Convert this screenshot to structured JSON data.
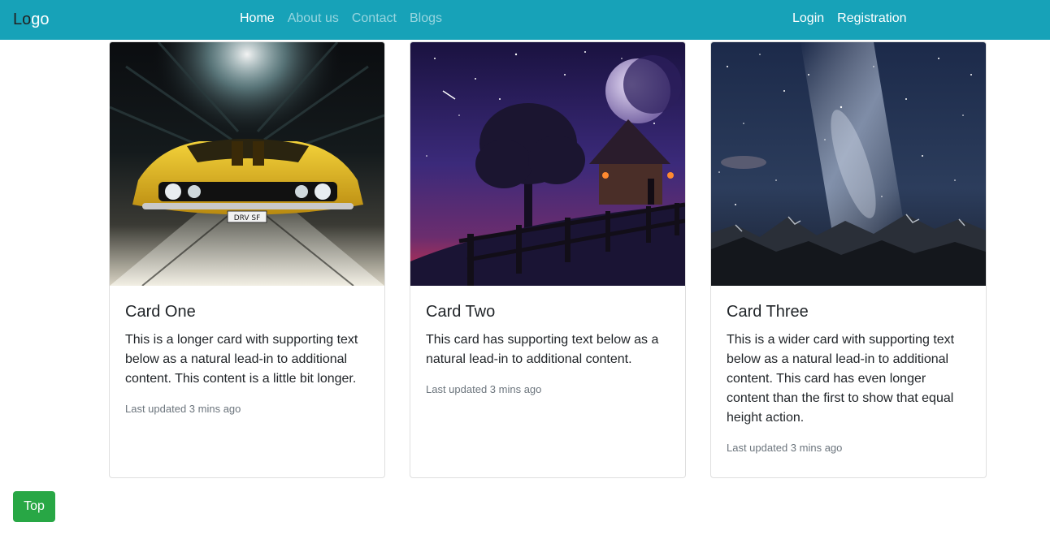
{
  "navbar": {
    "logo_part1": "Lo",
    "logo_part2": "go",
    "links": [
      {
        "label": "Home"
      },
      {
        "label": "About us"
      },
      {
        "label": "Contact"
      },
      {
        "label": "Blogs"
      }
    ],
    "login_label": "Login",
    "registration_label": "Registration",
    "background_color": "#17a2b8"
  },
  "cards": [
    {
      "title": "Card One",
      "text": "This is a longer card with supporting text below as a natural lead-in to additional content. This content is a little bit longer.",
      "updated": "Last updated 3 mins ago"
    },
    {
      "title": "Card Two",
      "text": "This card has supporting text below as a natural lead-in to additional content.",
      "updated": "Last updated 3 mins ago"
    },
    {
      "title": "Card Three",
      "text": "This is a wider card with supporting text below as a natural lead-in to additional content. This card has even longer content than the first to show that equal height action.",
      "updated": "Last updated 3 mins ago"
    }
  ],
  "top_button": {
    "label": "Top",
    "color": "#28a745"
  }
}
